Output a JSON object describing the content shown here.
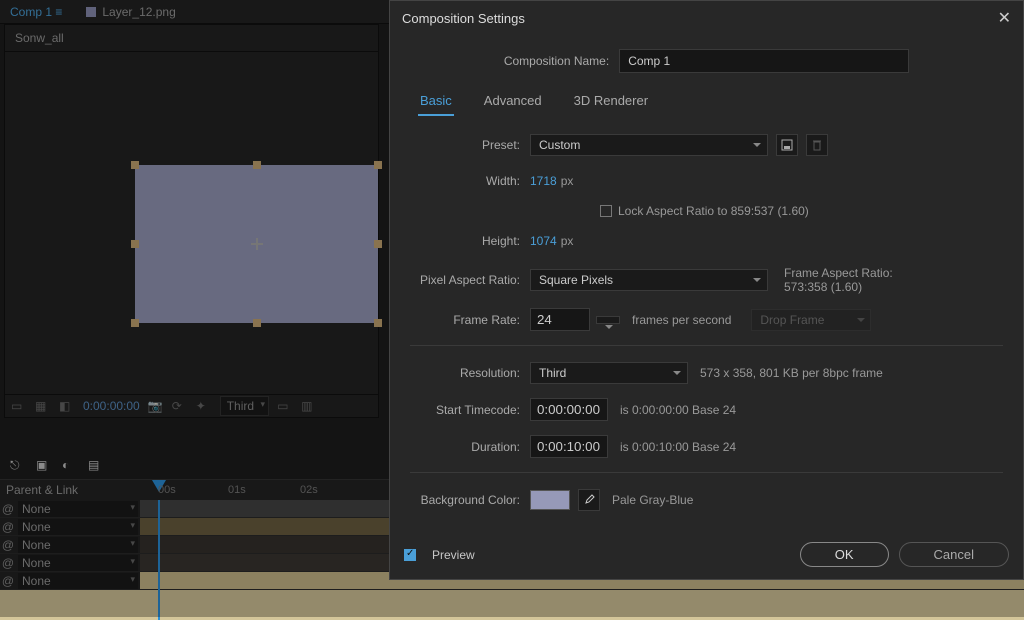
{
  "editor": {
    "tab_active": "Comp 1",
    "tab_layer": "Layer_12.png",
    "panel_name": "Sonw_all",
    "timecode": "0:00:00:00",
    "res_short": "Third",
    "ruler": {
      "t0": "00s",
      "t1": "01s",
      "t2": "02s"
    },
    "parent_link": "Parent & Link",
    "none": "None"
  },
  "dialog": {
    "title": "Composition Settings",
    "name_label": "Composition Name:",
    "name_value": "Comp 1",
    "tabs": {
      "basic": "Basic",
      "advanced": "Advanced",
      "renderer": "3D Renderer"
    },
    "preset_label": "Preset:",
    "preset_value": "Custom",
    "width_label": "Width:",
    "width_value": "1718",
    "height_label": "Height:",
    "height_value": "1074",
    "px": "px",
    "lock_label": "Lock Aspect Ratio to 859:537 (1.60)",
    "par_label": "Pixel Aspect Ratio:",
    "par_value": "Square Pixels",
    "frame_ar_label": "Frame Aspect Ratio:",
    "frame_ar_value": "573:358 (1.60)",
    "fps_label": "Frame Rate:",
    "fps_value": "24",
    "fps_text": "frames per second",
    "dropframe": "Drop Frame",
    "res_label": "Resolution:",
    "res_value": "Third",
    "res_info": "573 x 358, 801 KB per 8bpc frame",
    "start_label": "Start Timecode:",
    "start_value": "0:00:00:00",
    "start_info": "is 0:00:00:00  Base 24",
    "dur_label": "Duration:",
    "dur_value": "0:00:10:00",
    "dur_info": "is 0:00:10:00  Base 24",
    "bg_label": "Background Color:",
    "bg_name": "Pale Gray-Blue",
    "preview": "Preview",
    "ok": "OK",
    "cancel": "Cancel"
  }
}
